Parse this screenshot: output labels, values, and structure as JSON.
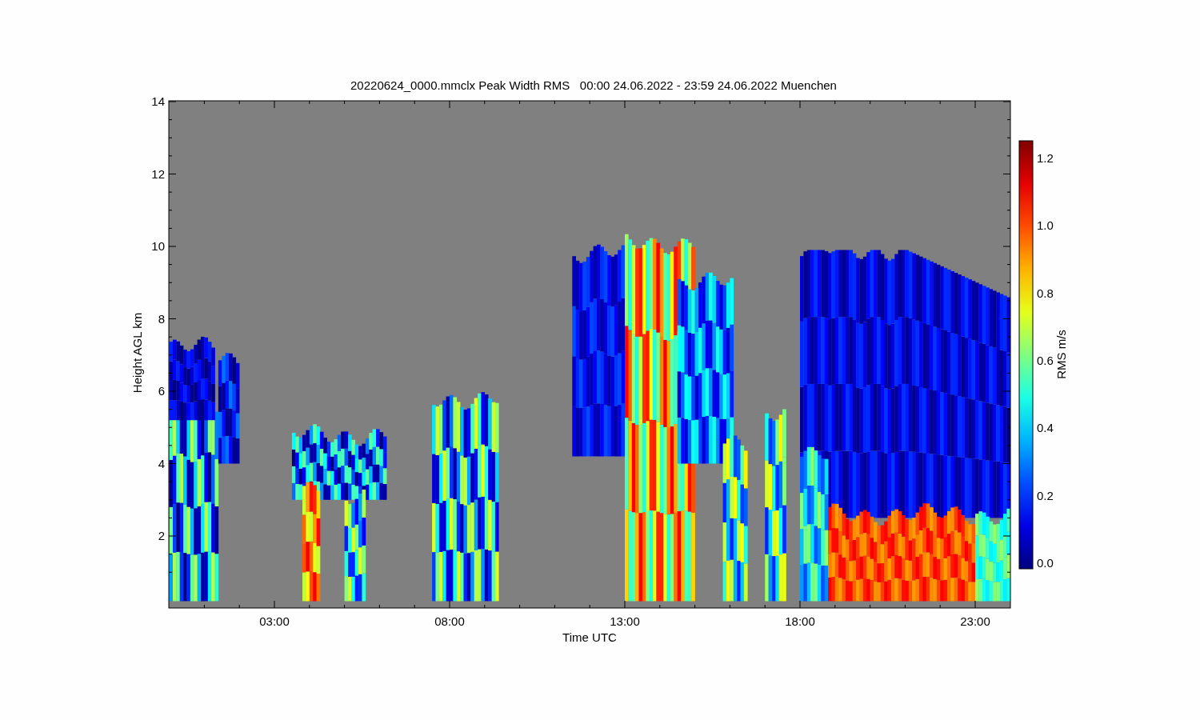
{
  "title": "20220624_0000.mmclx Peak Width RMS   00:00 24.06.2022 - 23:59 24.06.2022 Muenchen",
  "y_axis": {
    "label": "Height AGL km",
    "ticks": [
      "14",
      "12",
      "10",
      "8",
      "6",
      "4",
      "2"
    ]
  },
  "x_axis": {
    "label": "Time UTC",
    "ticks": [
      "03:00",
      "08:00",
      "13:00",
      "18:00",
      "23:00"
    ]
  },
  "colorbar": {
    "label": "RMS m/s",
    "ticks": [
      "1.2",
      "1.0",
      "0.8",
      "0.6",
      "0.4",
      "0.2",
      "0.0"
    ]
  }
}
